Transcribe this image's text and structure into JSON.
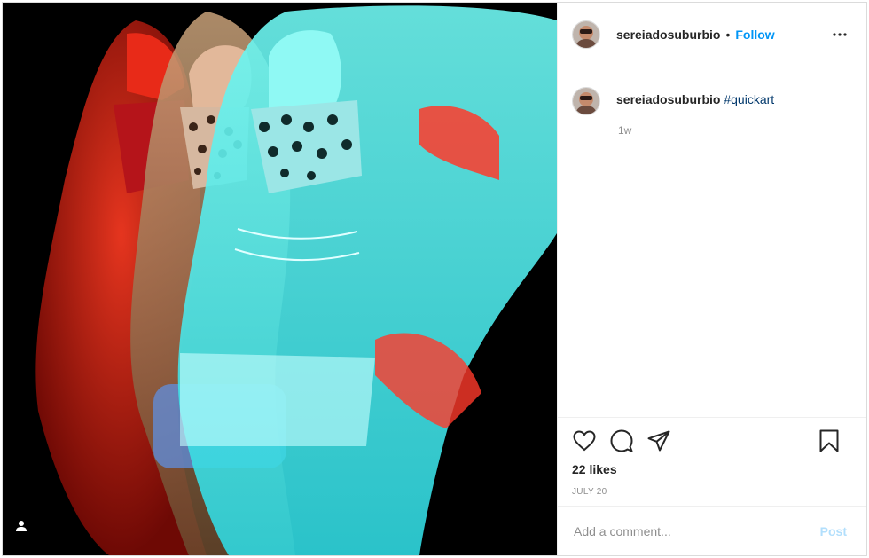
{
  "colors": {
    "accent": "#0095f6",
    "hashtag": "#00376b",
    "muted": "#8e8e8e",
    "post_disabled": "#b2dffc",
    "media_bg": "#000000",
    "red_layer": "#ff2a1a",
    "cyan_layer": "#5ff4f4"
  },
  "header": {
    "username": "sereiadosuburbio",
    "separator": "•",
    "follow_label": "Follow",
    "more_icon": "more-horizontal-icon"
  },
  "caption": {
    "username": "sereiadosuburbio",
    "hashtag": "#quickart",
    "time_ago": "1w"
  },
  "actions": {
    "like_icon": "heart-icon",
    "comment_icon": "comment-icon",
    "share_icon": "share-icon",
    "save_icon": "bookmark-icon",
    "likes": "22 likes",
    "date": "JULY 20"
  },
  "comment": {
    "placeholder": "Add a comment...",
    "post_label": "Post"
  },
  "media": {
    "tag_icon": "user-tag-icon"
  }
}
